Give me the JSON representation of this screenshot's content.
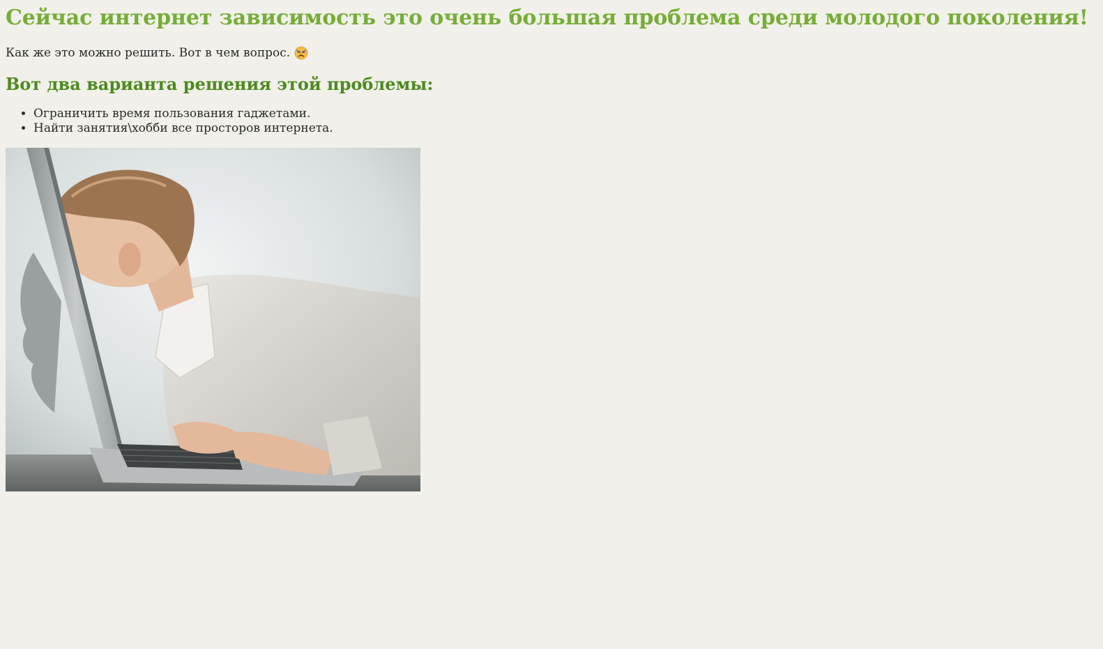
{
  "page": {
    "heading": "Сейчас интернет зависимость это очень большая проблема среди молодого поколения!",
    "intro_text": "Как же это можно решить. Вот в чем вопрос.",
    "emoji_icon": "sad-face-emoji-icon",
    "subheading": "Вот два варианта решения этой проблемы:",
    "solutions": [
      "Ограничить время пользования гаджетами.",
      "Найти занятия\\хобби все просторов интернета."
    ],
    "image_subject": "man-leaning-into-laptop-screen",
    "colors": {
      "background": "#f1f0ea",
      "heading": "#76ad37",
      "subheading": "#4d8a1f",
      "text": "#2a2a2a"
    }
  }
}
